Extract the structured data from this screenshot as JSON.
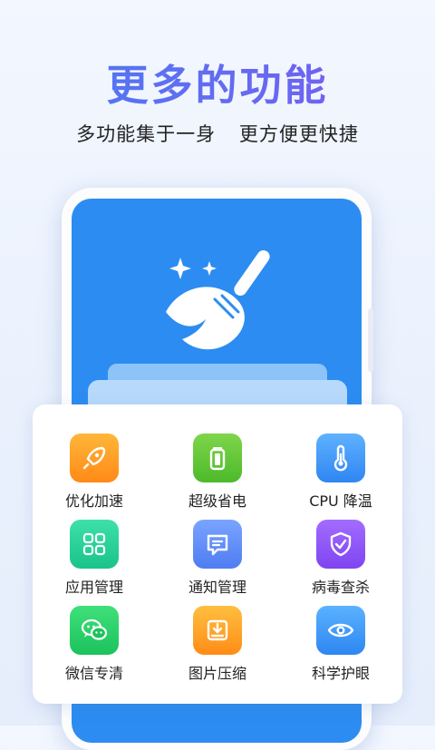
{
  "header": {
    "title": "更多的功能",
    "subtitle": "多功能集于一身 更方便更快捷"
  },
  "features": [
    {
      "label": "优化加速",
      "icon": "rocket-icon",
      "color_top": "#ffb63a",
      "color_bottom": "#ff8a16"
    },
    {
      "label": "超级省电",
      "icon": "battery-icon",
      "color_top": "#7fd54a",
      "color_bottom": "#4cba2a"
    },
    {
      "label": "CPU 降温",
      "icon": "thermometer-icon",
      "color_top": "#5fb1ff",
      "color_bottom": "#2f86f2"
    },
    {
      "label": "应用管理",
      "icon": "grid-apps-icon",
      "color_top": "#3ee0a8",
      "color_bottom": "#19c38a"
    },
    {
      "label": "通知管理",
      "icon": "message-icon",
      "color_top": "#7aa4ff",
      "color_bottom": "#4f7cf2"
    },
    {
      "label": "病毒查杀",
      "icon": "shield-check-icon",
      "color_top": "#a36cff",
      "color_bottom": "#7e45f0"
    },
    {
      "label": "微信专清",
      "icon": "wechat-icon",
      "color_top": "#3fe07a",
      "color_bottom": "#1cc25c"
    },
    {
      "label": "图片压缩",
      "icon": "image-compress-icon",
      "color_top": "#ffbf3f",
      "color_bottom": "#ff8c17"
    },
    {
      "label": "科学护眼",
      "icon": "eye-icon",
      "color_top": "#5bb2ff",
      "color_bottom": "#2e86f1"
    }
  ]
}
